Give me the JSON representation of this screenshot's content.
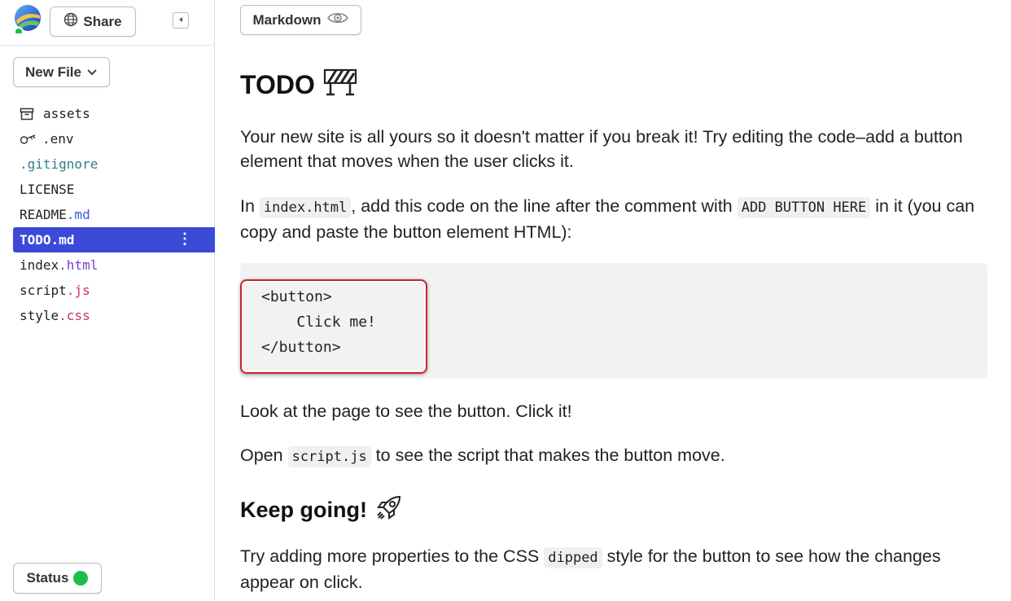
{
  "sidebar": {
    "share_label": "Share",
    "new_file_label": "New File",
    "status_label": "Status",
    "status_color": "#1ebd4a",
    "files": [
      {
        "base": "assets",
        "ext": "",
        "icon": "archive-icon"
      },
      {
        "base": ".env",
        "ext": "",
        "icon": "key-icon"
      },
      {
        "base": ".gitignore",
        "ext": ""
      },
      {
        "base": "LICENSE",
        "ext": ""
      },
      {
        "base": "README",
        "ext": ".md"
      },
      {
        "base": "TODO.md",
        "ext": "",
        "selected": true
      },
      {
        "base": "index",
        "ext": ".html"
      },
      {
        "base": "script",
        "ext": ".js"
      },
      {
        "base": "style",
        "ext": ".css"
      }
    ]
  },
  "main": {
    "view_mode_label": "Markdown",
    "title": "TODO",
    "title_emoji": "construction-icon",
    "p1": "Your new site is all yours so it doesn't matter if you break it! Try editing the code–add a button element that moves when the user clicks it.",
    "p2_a": "In ",
    "p2_code1": "index.html",
    "p2_b": ", add this code on the line after the comment with ",
    "p2_code2": "ADD BUTTON HERE",
    "p2_c": " in it (you can copy and paste the button element HTML):",
    "code_lines": [
      "<button>",
      "    Click me!",
      "</button>"
    ],
    "p3": "Look at the page to see the button. Click it!",
    "p4_a": "Open ",
    "p4_code": "script.js",
    "p4_b": " to see the script that makes the button move.",
    "h2": "Keep going!",
    "h2_emoji": "rocket-icon",
    "p5_a": "Try adding more properties to the CSS ",
    "p5_code": "dipped",
    "p5_b": " style for the button to see how the changes appear on click."
  }
}
